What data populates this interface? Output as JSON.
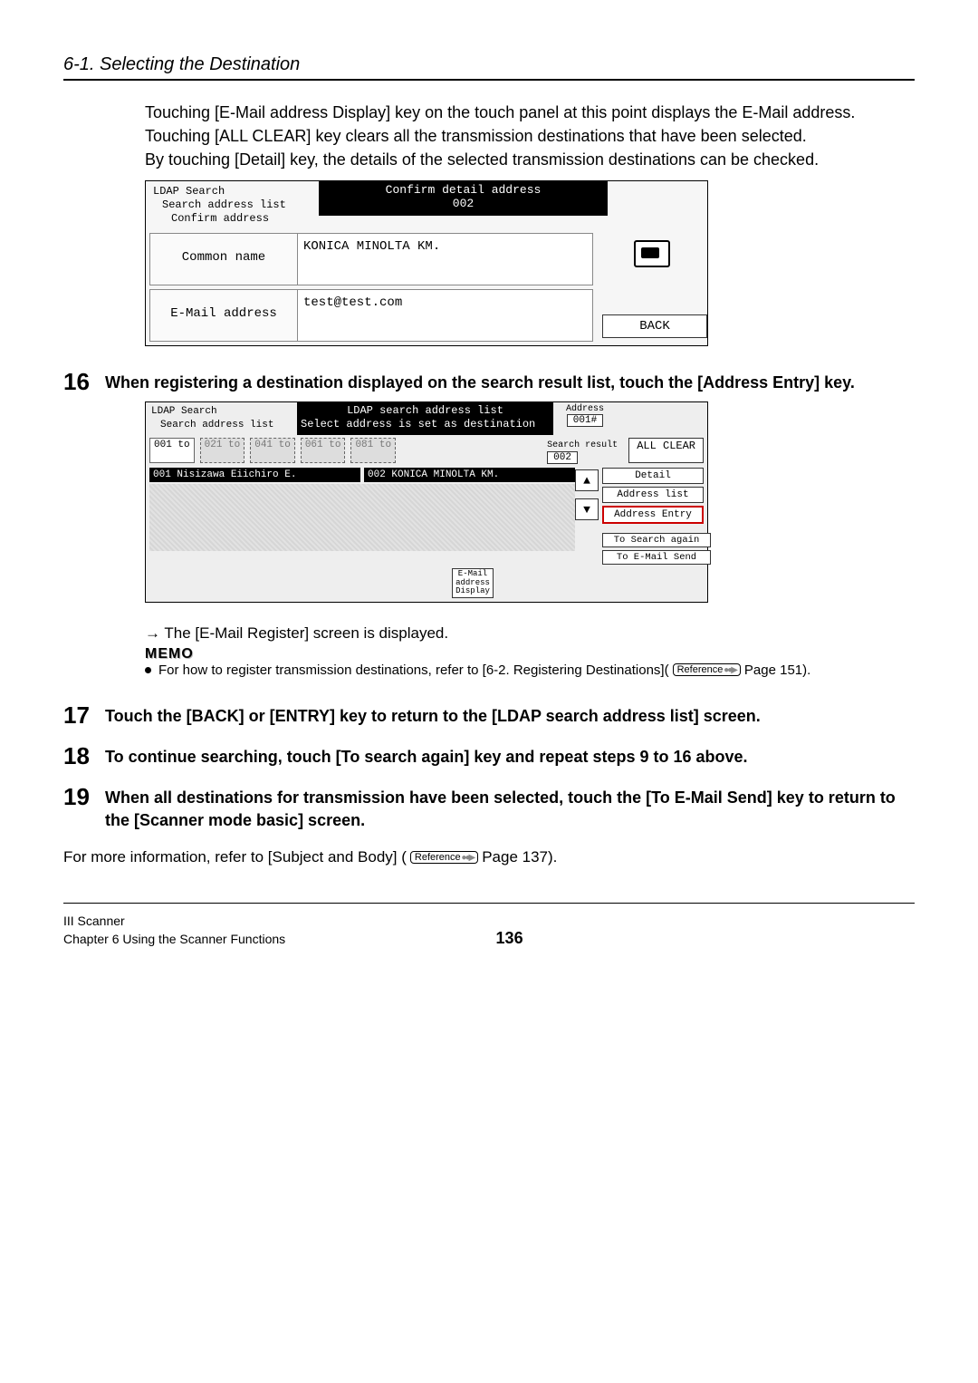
{
  "header": {
    "section": "6-1. Selecting the Destination"
  },
  "intro": {
    "p1": "Touching [E-Mail address Display] key on the touch panel at this point displays the E-Mail address.",
    "p2": "Touching [ALL CLEAR] key clears all the transmission destinations that have been selected.",
    "p3": "By touching [Detail] key, the details of the selected transmission destinations can be checked."
  },
  "panel1": {
    "bc1": "LDAP Search",
    "bc2": "Search address list",
    "bc3": "Confirm address",
    "title1": "Confirm detail address",
    "title2": "002",
    "row1_label": "Common name",
    "row1_value": "KONICA MINOLTA KM.",
    "row2_label": "E-Mail address",
    "row2_value": "test@test.com",
    "back": "BACK"
  },
  "step16": {
    "num": "16",
    "text": "When registering a destination displayed on the search result list, touch the [Address Entry] key."
  },
  "panel2": {
    "bc1": "LDAP Search",
    "bc2": "Search address list",
    "title1": "LDAP search address list",
    "title2": "Select address is set as destination",
    "addr_label": "Address",
    "addr_value": "001#",
    "pages": [
      "001 to",
      "021 to",
      "041 to",
      "061 to",
      "081 to"
    ],
    "search_result_label": "Search result",
    "search_result_value": "002",
    "all_clear": "ALL CLEAR",
    "result1": "001 Nisizawa Eiichiro E.",
    "result2": "002 KONICA MINOLTA KM.",
    "side": {
      "detail": "Detail",
      "addrlist": "Address list",
      "addrentry": "Address Entry",
      "search_again": "To Search again",
      "email_send": "To E-Mail Send"
    },
    "mini_label": "E-Mail\naddress\nDisplay"
  },
  "after16": {
    "arrow_note": "→ The [E-Mail Register] screen is displayed.",
    "memo_label": "MEMO",
    "memo_text_a": "For how to register transmission destinations, refer to [6-2. Registering Destinations](",
    "memo_text_b": " Page 151).",
    "ref": "Reference"
  },
  "step17": {
    "num": "17",
    "text": "Touch the [BACK] or [ENTRY] key to return to the [LDAP search address list] screen."
  },
  "step18": {
    "num": "18",
    "text": "To continue searching, touch [To search again] key and repeat steps 9 to 16 above."
  },
  "step19": {
    "num": "19",
    "text": "When all destinations for transmission have been selected, touch the [To E-Mail Send] key to return to the [Scanner mode basic] screen."
  },
  "final": {
    "a": "For more information, refer to [Subject and Body] (",
    "ref": "Reference",
    "b": " Page 137)."
  },
  "footer": {
    "l1": "III Scanner",
    "l2": "Chapter 6 Using the Scanner Functions",
    "page": "136"
  }
}
